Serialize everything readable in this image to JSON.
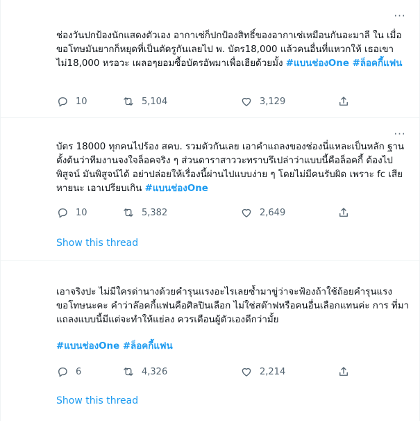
{
  "tweets": [
    {
      "text": "ช่องวันปกป้องนักแสดงตัวเอง อากาเซ่ก็ปกป้องสิทธิ์ของอากาเซ่เหมือนกันอะมาลี ใน เมื่อขอโทษมันยากก็หยุดที่เป็นตัดรูกันเลยไป พ. บัตร18,000 แล้วคนอื่นที่แหวกให้ เธอเขาไม่18,000 หรอวะ เผลอๆยอมซื้อบัตรอัพมาเพื่อเฮียด้วยมั้ง",
      "hashtags": "#แบนช่องOne #ล็อคกี้แฟน",
      "replies": "10",
      "retweets": "5,104",
      "likes": "3,129"
    },
    {
      "text": "บัตร 18000 ทุกคนไปร้อง สคบ.  รวมตัวกันเลย เอาคำแถลงของช่องนี่แหละเป็นหลัก ฐานตั้งต้นว่าทีมงานจงใจล็อคจริง ๆ ส่วนดาราสาววะทราบรึเปล่าว่าแบบนี้คือล็อคกี้ ต้องไปพิสูจน์ มันพิสูจน์ได้ อย่าปล่อยให้เรื่องนี้ผ่านไปแบบง่าย ๆ โดยไม่มีคนรับผิด เพราะ fc เสียหายนะ เอาเปรียบเกิน",
      "hashtags": "#แบนช่องOne",
      "replies": "10",
      "retweets": "5,382",
      "likes": "2,649",
      "show_thread": "Show this thread"
    },
    {
      "text": "เอาจริงปะ ไม่มีใครด่านางด้วยคำรุนแรงอะไรเลยซ้ำมาขู่ว่าจะฟ้องถ้าใช้ถ้อยคำรุนแรง ขอโทษนะคะ คำว่าล๊อคกี้แฟนคือศิลปินเลือก ไม่ใช่สต๊าฟหรือคนอื่นเลือกแทนค่ะ การ ที่มาแถลงแบบนี้มีแต่จะทำให้แย่ลง ควรเตือนผู้ตัวเองดีกว่ามั้ย",
      "hashtags": "#แบนช่องOne #ล็อคกี้แฟน",
      "replies": "6",
      "retweets": "4,326",
      "likes": "2,214",
      "show_thread": "Show this thread"
    }
  ],
  "more_glyph": "···",
  "icons": [
    "reply-icon",
    "retweet-icon",
    "like-icon",
    "share-icon",
    "more-icon"
  ],
  "accent": "#1d9bf0"
}
